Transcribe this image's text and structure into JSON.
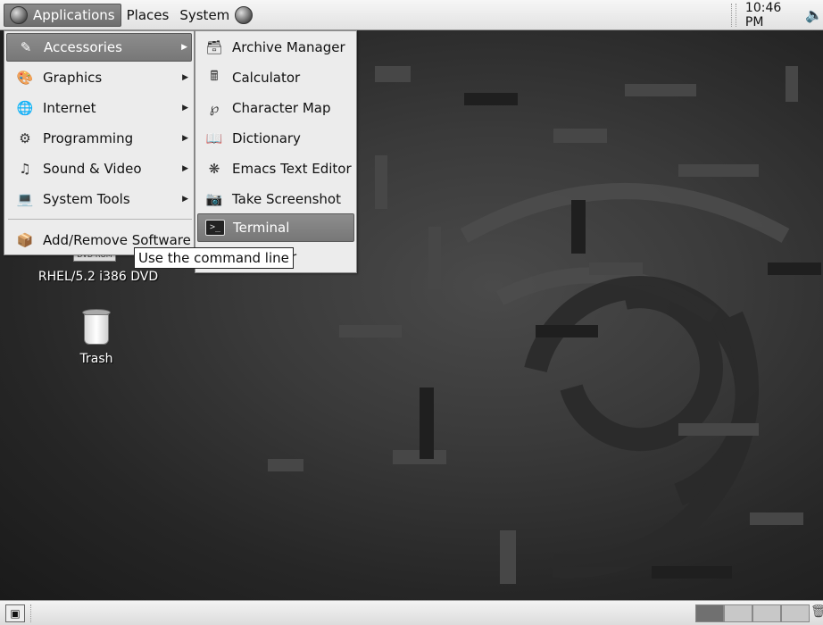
{
  "top_panel": {
    "menus": [
      {
        "label": "Applications",
        "icon": "distro-logo-icon",
        "active": true
      },
      {
        "label": "Places",
        "icon": null,
        "active": false
      },
      {
        "label": "System",
        "icon": null,
        "active": false
      }
    ],
    "launcher_icon": "browser-globe-icon",
    "clock": "10:46 PM",
    "volume_icon": "speaker-icon"
  },
  "applications_menu": {
    "items": [
      {
        "label": "Accessories",
        "icon": "accessories-icon",
        "has_submenu": true,
        "highlighted": true
      },
      {
        "label": "Graphics",
        "icon": "graphics-icon",
        "has_submenu": true,
        "highlighted": false
      },
      {
        "label": "Internet",
        "icon": "internet-icon",
        "has_submenu": true,
        "highlighted": false
      },
      {
        "label": "Programming",
        "icon": "programming-icon",
        "has_submenu": true,
        "highlighted": false
      },
      {
        "label": "Sound & Video",
        "icon": "sound-video-icon",
        "has_submenu": true,
        "highlighted": false
      },
      {
        "label": "System Tools",
        "icon": "system-tools-icon",
        "has_submenu": true,
        "highlighted": false
      },
      {
        "label": "Add/Remove Software",
        "icon": "add-remove-software-icon",
        "has_submenu": false,
        "highlighted": false
      }
    ]
  },
  "accessories_submenu": {
    "items": [
      {
        "label": "Archive Manager",
        "icon": "archive-manager-icon",
        "highlighted": false
      },
      {
        "label": "Calculator",
        "icon": "calculator-icon",
        "highlighted": false
      },
      {
        "label": "Character Map",
        "icon": "character-map-icon",
        "highlighted": false
      },
      {
        "label": "Dictionary",
        "icon": "dictionary-icon",
        "highlighted": false
      },
      {
        "label": "Emacs Text Editor",
        "icon": "emacs-icon",
        "highlighted": false
      },
      {
        "label": "Take Screenshot",
        "icon": "camera-icon",
        "highlighted": false
      },
      {
        "label": "Terminal",
        "icon": "terminal-icon",
        "highlighted": true
      }
    ],
    "partially_hidden_item_tail": "r"
  },
  "tooltip": {
    "text": "Use the command line"
  },
  "desktop": {
    "icons": [
      {
        "label": "RHEL/5.2 i386 DVD",
        "badge": "DVD-ROM",
        "icon": "dvd-icon"
      },
      {
        "label": "Trash",
        "icon": "trash-icon"
      }
    ]
  },
  "bottom_panel": {
    "show_desktop_icon": "show-desktop-icon",
    "workspaces": [
      {
        "current": true
      },
      {
        "current": false
      },
      {
        "current": false
      },
      {
        "current": false
      }
    ],
    "trash_applet_icon": "trash-applet-icon"
  },
  "colors": {
    "highlight": "#808080",
    "panel": "#e8e8e8",
    "menu_bg": "#ececec",
    "desktop_bg": "#333333"
  }
}
